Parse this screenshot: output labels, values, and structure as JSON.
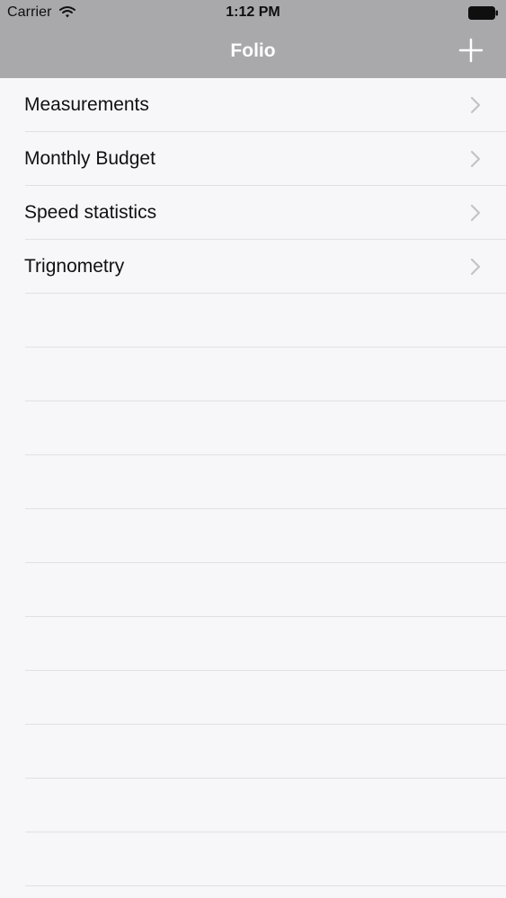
{
  "status_bar": {
    "carrier": "Carrier",
    "time": "1:12 PM",
    "wifi_icon": "wifi-icon",
    "battery_icon": "battery-icon"
  },
  "nav_bar": {
    "title": "Folio",
    "add_icon": "plus-icon",
    "background_color": "#a9a8aa",
    "title_color": "#ffffff"
  },
  "list": {
    "items": [
      {
        "label": "Measurements",
        "icon": "chevron-right-icon"
      },
      {
        "label": "Monthly Budget",
        "icon": "chevron-right-icon"
      },
      {
        "label": "Speed statistics",
        "icon": "chevron-right-icon"
      },
      {
        "label": "Trignometry",
        "icon": "chevron-right-icon"
      }
    ],
    "background_color": "#f7f6f9",
    "separator_color": "#e1e0e3"
  }
}
